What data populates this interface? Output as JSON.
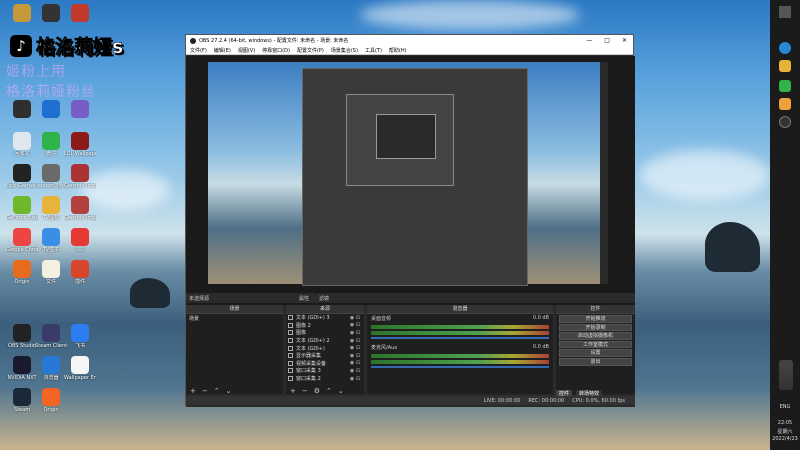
{
  "colors": {
    "accent": "#2b2b2b",
    "taskbar": "#1b1b1b"
  },
  "brand": {
    "logo_glyph": "♪",
    "text": "格洛莉娅s"
  },
  "overlay_text": [
    "姬粉上用",
    "格洛莉娅粉丝"
  ],
  "desktop_icons": [
    {
      "label": "",
      "color": "#c49a3a"
    },
    {
      "label": "",
      "color": "#333"
    },
    {
      "label": "",
      "color": "#c0392b"
    },
    {
      "label": "",
      "color": "#2f2f2f"
    },
    {
      "label": "",
      "color": "#1f6fd1"
    },
    {
      "label": "",
      "color": "#7a5cc7"
    },
    {
      "label": "回收站",
      "color": "#dfe6ee"
    },
    {
      "label": "微信",
      "color": "#2fb34a"
    },
    {
      "label": "LOL Wallpaper",
      "color": "#8b1a1a"
    },
    {
      "label": "Epic Games Launcher",
      "color": "#222"
    },
    {
      "label": "steam游戏",
      "color": "#6a6a6a"
    },
    {
      "label": "Genshin Impact",
      "color": "#a33"
    },
    {
      "label": "GeForce Experience",
      "color": "#6fb82b"
    },
    {
      "label": "TV图标",
      "color": "#e8b33a"
    },
    {
      "label": "Genshin Impact",
      "color": "#b4413d"
    },
    {
      "label": "Google Chrome",
      "color": "#e44"
    },
    {
      "label": "TV盒子",
      "color": "#3a8ee6"
    },
    {
      "label": "UU",
      "color": "#e53935"
    },
    {
      "label": "Origin",
      "color": "#e86a1c"
    },
    {
      "label": "文件",
      "color": "#f4f0e0"
    },
    {
      "label": "插件",
      "color": "#d9452a"
    },
    {
      "label": "OBS Studio",
      "color": "#222"
    },
    {
      "label": "Steam Client",
      "color": "#3b3b6b"
    },
    {
      "label": "飞书",
      "color": "#2d7cf0"
    },
    {
      "label": "NVIDIA NXT",
      "color": "#1a1a2e"
    },
    {
      "label": "浏览器",
      "color": "#2878d6"
    },
    {
      "label": "Wallpaper Engine",
      "color": "#f5f5f5"
    },
    {
      "label": "Steam",
      "color": "#1b2838"
    },
    {
      "label": "Origin",
      "color": "#f26522"
    }
  ],
  "obs": {
    "title": "OBS 27.2.4 (64-bit, windows) - 配置文件: 未命名 - 场景: 未命名",
    "window_controls": [
      "—",
      "□",
      "✕"
    ],
    "menu": [
      "文件(F)",
      "编辑(E)",
      "视图(V)",
      "停靠窗口(D)",
      "配置文件(P)",
      "场景集合(S)",
      "工具(T)",
      "帮助(H)"
    ],
    "source_bar": {
      "label": "未选择源",
      "prop": "属性",
      "filter": "滤镜"
    },
    "docks": {
      "scenes": "场景",
      "sources": "来源",
      "mixer": "混音器",
      "controls": "控件"
    },
    "scenes": [
      "场景"
    ],
    "sources": [
      "文本 (GDI+) 3",
      "图像 2",
      "图像",
      "文本 (GDI+) 2",
      "文本 (GDI+)",
      "显示器采集",
      "视频采集设备",
      "窗口采集 3",
      "窗口采集 2"
    ],
    "mixer": [
      {
        "name": "桌面音频",
        "db": "0.0 dB"
      },
      {
        "name": "麦克风/Aux",
        "db": "0.0 dB"
      }
    ],
    "controls": [
      "开始推流",
      "开始录制",
      "启动虚拟摄像机",
      "工作室模式",
      "设置",
      "退出"
    ],
    "controls_tabs": [
      "控件",
      "转场特效"
    ],
    "status": [
      "LIVE: 00:00:00",
      "REC: 00:00:00",
      "CPU: 0.0%, 60.00 fps"
    ]
  },
  "taskbar": {
    "lang": "ENG",
    "time": "22:05",
    "weekday": "星期六",
    "date": "2022/4/23"
  }
}
